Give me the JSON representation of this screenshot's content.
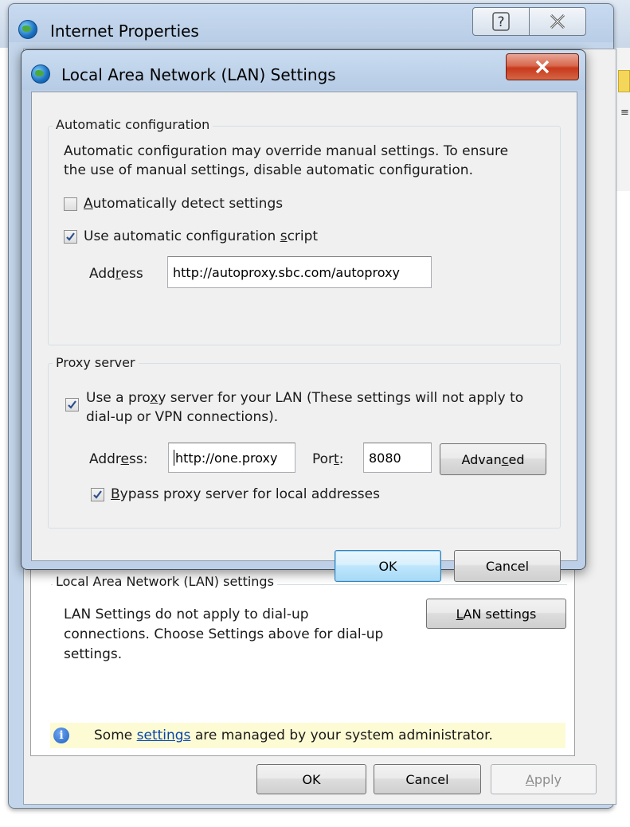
{
  "outer_window": {
    "title": "Internet Properties",
    "help_button": "?",
    "close_button": "X",
    "lan_group_label": "Local Area Network (LAN) settings",
    "lan_description_lines": [
      "LAN Settings do not apply to dial-up",
      "connections. Choose Settings above for dial-up",
      "settings."
    ],
    "lan_settings_button": {
      "prefix": "",
      "mnemonic": "L",
      "rest": "AN settings"
    },
    "info_bar": {
      "text_before": "Some ",
      "link": "settings",
      "text_after": " are managed by your system administrator."
    },
    "ok_button": "OK",
    "cancel_button": "Cancel",
    "apply_button": {
      "mnemonic": "A",
      "rest": "pply"
    }
  },
  "lan_dialog": {
    "title": "Local Area Network (LAN) Settings",
    "close_button": "X",
    "auto_config": {
      "legend": "Automatic configuration",
      "description_lines": [
        "Automatic configuration may override manual settings.  To ensure",
        "the use of manual settings, disable automatic configuration."
      ],
      "auto_detect": {
        "mnemonic": "A",
        "rest": "utomatically detect settings",
        "checked": false
      },
      "use_script": {
        "prefix": "Use automatic configuration ",
        "mnemonic": "s",
        "rest": "cript",
        "checked": true
      },
      "address_label": {
        "prefix": "Add",
        "mnemonic": "r",
        "rest": "ess"
      },
      "address_value": "http://autoproxy.sbc.com/autoproxy"
    },
    "proxy": {
      "legend": "Proxy server",
      "use_proxy_line1": {
        "prefix": "Use a pro",
        "mnemonic": "x",
        "rest": "y server for your LAN (These settings will not apply to"
      },
      "use_proxy_line2": "dial-up or VPN connections).",
      "use_proxy_checked": true,
      "address_label": {
        "prefix": "Addr",
        "mnemonic": "e",
        "rest": "ss:"
      },
      "address_value": "http://one.proxy",
      "port_label": {
        "prefix": "Por",
        "mnemonic": "t",
        "rest": ":"
      },
      "port_value": "8080",
      "advanced_button": {
        "prefix": "Advan",
        "mnemonic": "c",
        "rest": "ed"
      },
      "bypass": {
        "mnemonic": "B",
        "rest": "ypass proxy server for local addresses",
        "checked": true
      }
    },
    "ok_button": "OK",
    "cancel_button": "Cancel"
  },
  "icons": [
    "globe-icon",
    "help-icon",
    "close-icon",
    "checkbox-check-icon",
    "info-icon"
  ],
  "colors": {
    "title_bar": "#b9cde6",
    "close_red": "#c8391c",
    "default_button_border": "#3c7fb1",
    "info_bar_bg": "#fdfbd4",
    "link": "#0645ad"
  }
}
